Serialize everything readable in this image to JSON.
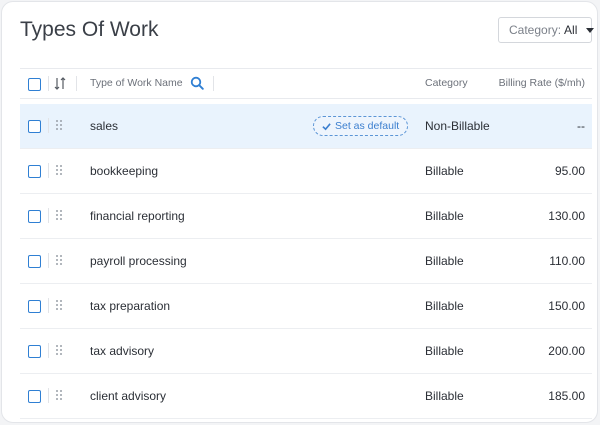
{
  "page": {
    "title": "Types Of Work"
  },
  "filter": {
    "label": "Category:",
    "value": "All"
  },
  "table": {
    "headers": {
      "name": "Type of Work Name",
      "category": "Category",
      "rate": "Billing Rate ($/mh)"
    },
    "set_default_label": "Set as default",
    "rows": [
      {
        "name": "sales",
        "category": "Non-Billable",
        "rate": "--"
      },
      {
        "name": "bookkeeping",
        "category": "Billable",
        "rate": "95.00"
      },
      {
        "name": "financial reporting",
        "category": "Billable",
        "rate": "130.00"
      },
      {
        "name": "payroll processing",
        "category": "Billable",
        "rate": "110.00"
      },
      {
        "name": "tax preparation",
        "category": "Billable",
        "rate": "150.00"
      },
      {
        "name": "tax advisory",
        "category": "Billable",
        "rate": "200.00"
      },
      {
        "name": "client advisory",
        "category": "Billable",
        "rate": "185.00"
      }
    ]
  },
  "icons": {
    "sort": "sort-arrows-icon",
    "search": "search-icon",
    "drag": "drag-handle-icon",
    "check": "check-icon",
    "caret": "caret-down-icon"
  },
  "colors": {
    "accent": "#2f7fd3",
    "selected_row": "#e9f3fd"
  }
}
